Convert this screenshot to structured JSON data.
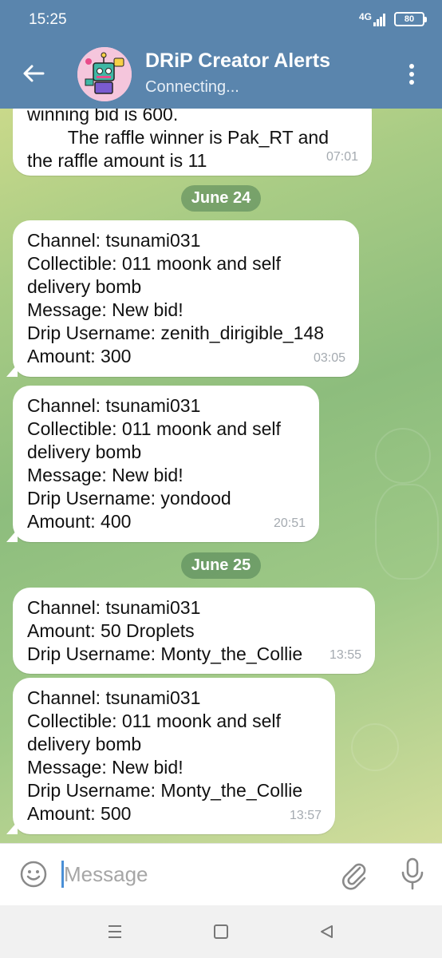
{
  "status_bar": {
    "time": "15:25",
    "network": "4G",
    "battery": "80"
  },
  "header": {
    "title": "DRiP Creator Alerts",
    "subtitle": "Connecting..."
  },
  "messages": [
    {
      "lines": [
        "winning bid is 600.",
        "        The raffle winner is Pak_RT and",
        "the raffle amount is 11"
      ],
      "time": "07:01"
    },
    {
      "date": "June 24"
    },
    {
      "lines": [
        "Channel: tsunami031",
        "Collectible: 011 moonk and self",
        "delivery bomb",
        "Message: New bid!",
        "Drip Username: zenith_dirigible_148",
        "Amount: 300"
      ],
      "time": "03:05"
    },
    {
      "lines": [
        "Channel: tsunami031",
        "Collectible: 011 moonk and self",
        "delivery bomb",
        "Message: New bid!",
        "Drip Username: yondood",
        "Amount: 400"
      ],
      "time": "20:51"
    },
    {
      "date": "June 25"
    },
    {
      "lines": [
        "Channel: tsunami031",
        "Amount: 50 Droplets",
        "Drip Username: Monty_the_Collie"
      ],
      "time": "13:55"
    },
    {
      "lines": [
        "Channel: tsunami031",
        "Collectible: 011 moonk and self",
        "delivery bomb",
        "Message: New bid!",
        "Drip Username: Monty_the_Collie",
        "Amount: 500"
      ],
      "time": "13:57"
    }
  ],
  "input": {
    "placeholder": "Message"
  },
  "icons": {
    "back": "arrow-left-icon",
    "menu": "more-vertical-icon",
    "emoji": "emoji-icon",
    "attach": "paperclip-icon",
    "mic": "microphone-icon"
  },
  "colors": {
    "header": "#5a85ad",
    "date_pill": "#4e8054",
    "bubble": "#ffffff",
    "cursor": "#4a8fd6"
  }
}
